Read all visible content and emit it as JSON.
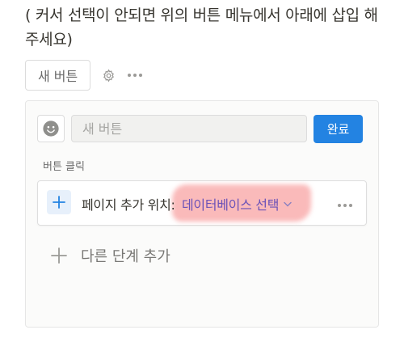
{
  "instruction_text": "( 커서 선택이 안되면 위의 버튼 메뉴에서 아래에 삽입 해주세요)",
  "button_preview": {
    "label": "새 버튼",
    "settings_icon": "gear-icon",
    "more_icon": "more-horizontal-icon"
  },
  "editor": {
    "emoji_icon": "smiley-icon",
    "name_placeholder": "새 버튼",
    "done_label": "완료",
    "done_color": "#2383e2",
    "section_label": "버튼 클릭",
    "step": {
      "add_icon": "plus-icon",
      "action_text": "페이지 추가 위치:",
      "database_label": "데이터베이스 선택",
      "database_icon": "chevron-down-icon",
      "more_icon": "more-horizontal-icon",
      "highlight_color": "#f68282"
    },
    "add_step_label": "다른 단계 추가",
    "add_step_icon": "plus-icon"
  }
}
